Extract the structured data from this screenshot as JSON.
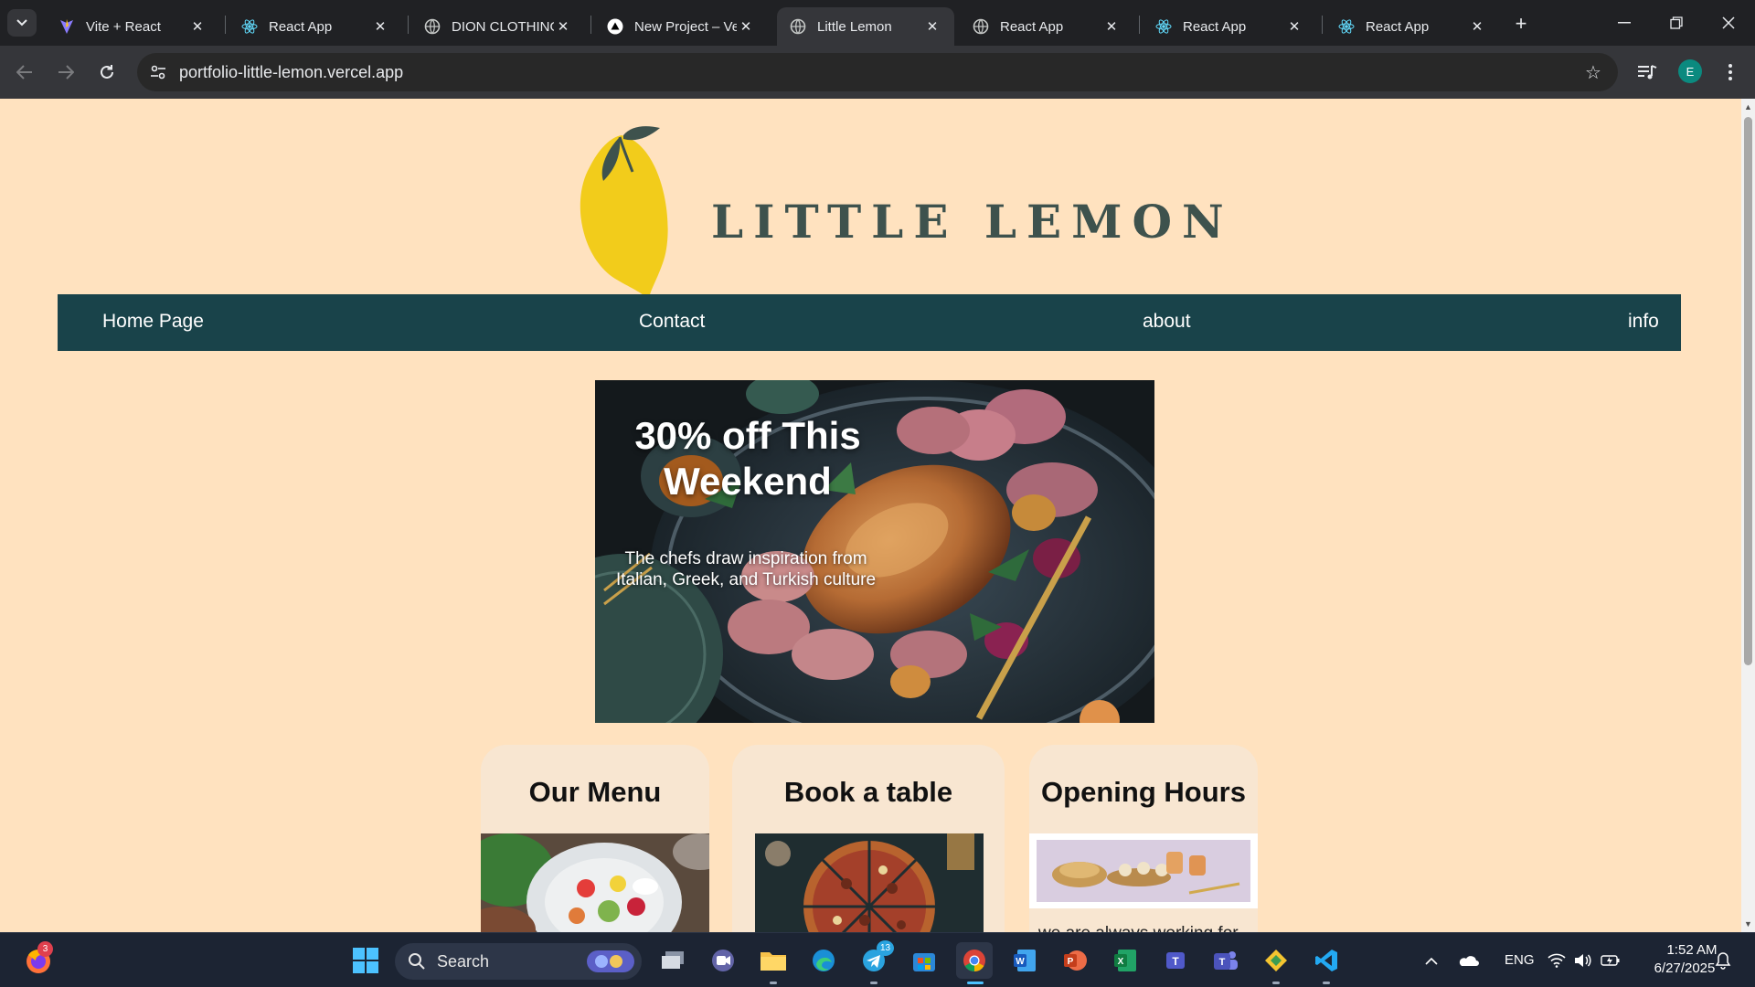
{
  "browser": {
    "tabs": [
      {
        "title": "Vite + React",
        "icon": "vite-icon"
      },
      {
        "title": "React App",
        "icon": "react-icon"
      },
      {
        "title": "DION CLOTHING",
        "icon": "globe-icon"
      },
      {
        "title": "New Project – Ve",
        "icon": "vercel-icon"
      },
      {
        "title": "Little Lemon",
        "icon": "globe-icon",
        "active": true
      },
      {
        "title": "React App",
        "icon": "globe-icon"
      },
      {
        "title": "React App",
        "icon": "react-icon"
      },
      {
        "title": "React App",
        "icon": "react-icon"
      }
    ],
    "url": "portfolio-little-lemon.vercel.app",
    "profile_initial": "E"
  },
  "site": {
    "brand": "LITTLE LEMON",
    "nav": [
      "Home Page",
      "Contact",
      "about",
      "info"
    ],
    "hero": {
      "title": "30% off This Weekend",
      "subtitle": "The chefs draw inspiration from Italian, Greek, and Turkish culture"
    },
    "cards": [
      {
        "title": "Our Menu"
      },
      {
        "title": "Book a table"
      },
      {
        "title": "Opening Hours",
        "text": "we are always working for"
      }
    ],
    "colors": {
      "background": "#ffe2bf",
      "nav": "#19434a",
      "brand_text": "#3e524d",
      "lemon": "#f2cc1b"
    }
  },
  "taskbar": {
    "search_label": "Search",
    "firefox_badge": "3",
    "telegram_badge": "13",
    "language": "ENG",
    "time": "1:52 AM",
    "date": "6/27/2025"
  }
}
